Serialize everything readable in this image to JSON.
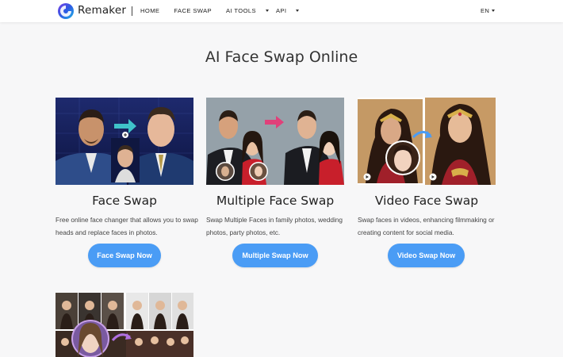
{
  "header": {
    "brand": "Remaker",
    "nav": [
      {
        "label": "HOME",
        "has_caret": false
      },
      {
        "label": "FACE SWAP",
        "has_caret": false
      },
      {
        "label": "AI TOOLS",
        "has_caret": true
      },
      {
        "label": "API",
        "has_caret": true
      }
    ],
    "lang": "EN"
  },
  "page": {
    "title": "AI Face Swap Online"
  },
  "cards": [
    {
      "title": "Face Swap",
      "description": "Free online face changer that allows you to swap heads and replace faces in photos.",
      "button": "Face Swap Now"
    },
    {
      "title": "Multiple Face Swap",
      "description": "Swap Multiple Faces in family photos, wedding photos, party photos, etc.",
      "button": "Multiple Swap Now"
    },
    {
      "title": "Video Face Swap",
      "description": "Swap faces in videos, enhancing filmmaking or creating content for social media.",
      "button": "Video Swap Now"
    }
  ],
  "colors": {
    "accent": "#4a9cf5",
    "arrow_pink": "#e0407a"
  }
}
